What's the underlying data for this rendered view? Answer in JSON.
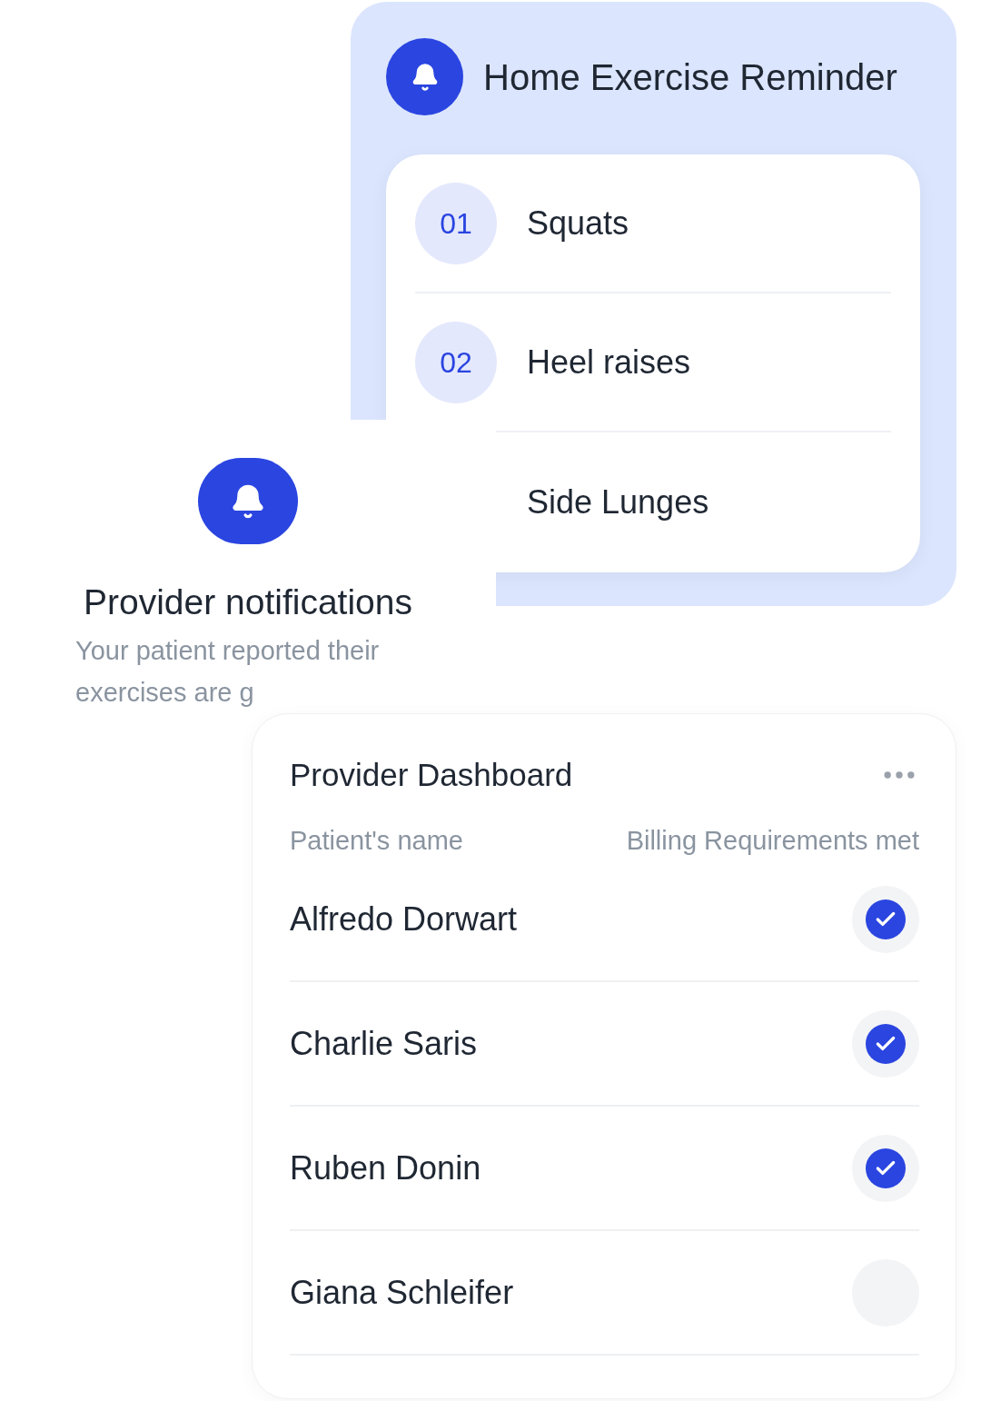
{
  "reminder": {
    "title": "Home Exercise Reminder",
    "exercises": [
      {
        "number": "01",
        "name": "Squats"
      },
      {
        "number": "02",
        "name": "Heel raises"
      },
      {
        "name": "Side Lunges"
      }
    ]
  },
  "notification": {
    "title": "Provider notifications",
    "lines": [
      "Your patient reported their",
      "exercises are g"
    ]
  },
  "dashboard": {
    "title": "Provider Dashboard",
    "columns": [
      "Patient's name",
      "Billing Requirements met"
    ],
    "rows": [
      {
        "name": "Alfredo Dorwart",
        "checked": true
      },
      {
        "name": "Charlie Saris",
        "checked": true
      },
      {
        "name": "Ruben Donin",
        "checked": true
      },
      {
        "name": "Giana Schleifer",
        "checked": false
      }
    ]
  }
}
